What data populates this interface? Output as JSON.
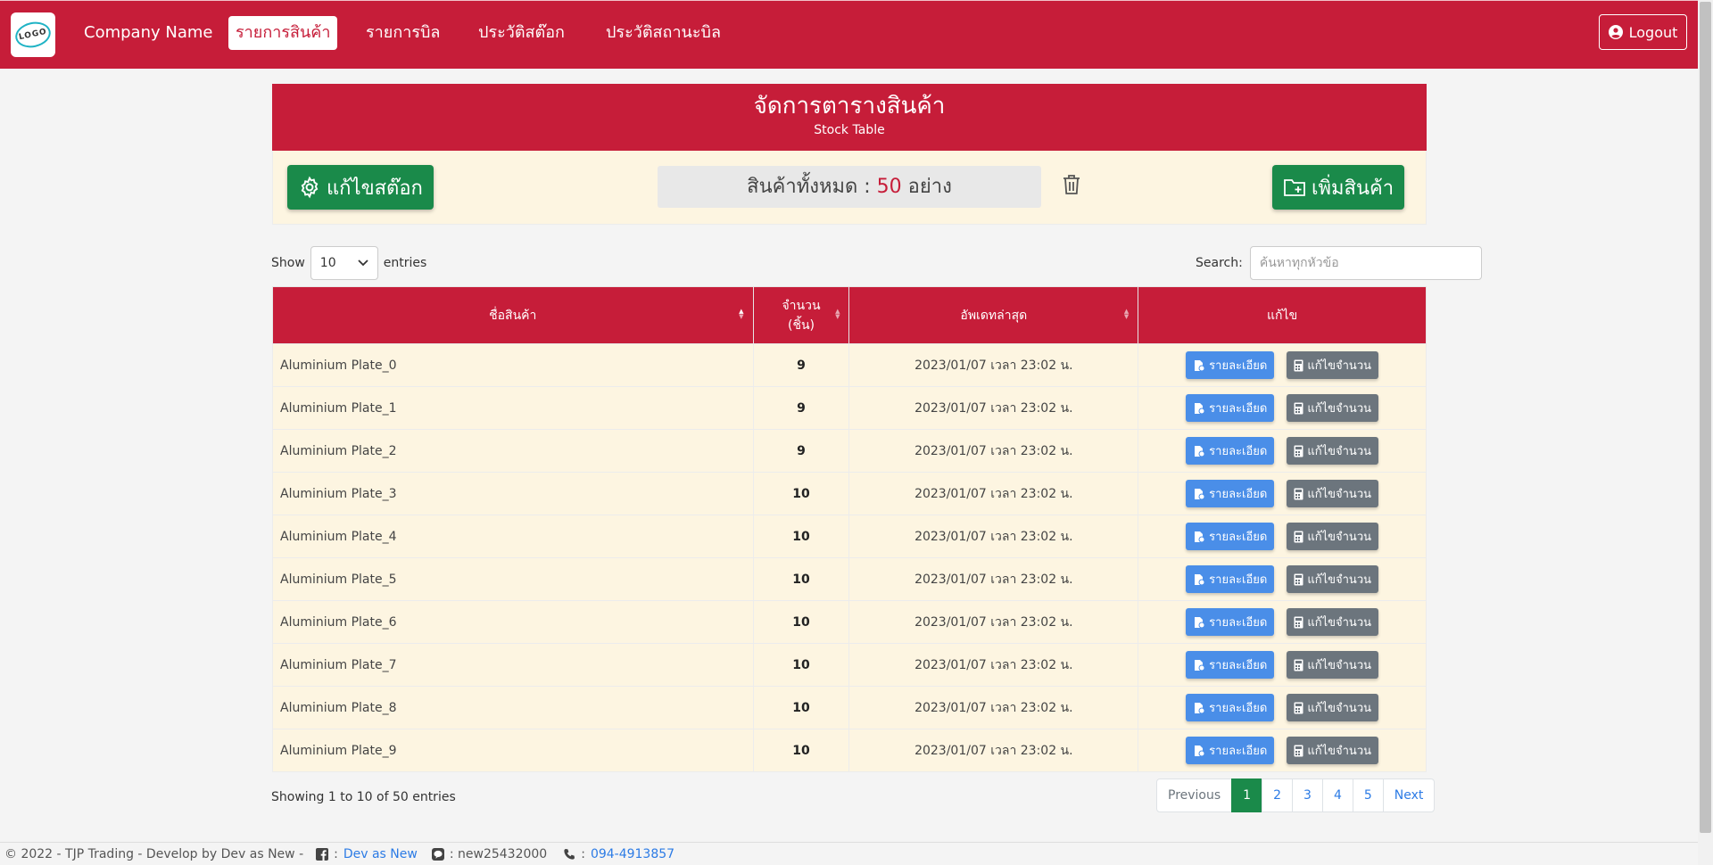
{
  "nav": {
    "logo_text": "LOGO",
    "company": "Company Name",
    "links": [
      "รายการสินค้า",
      "รายการบิล",
      "ประวัติสต๊อก",
      "ประวัติสถานะบิล"
    ],
    "logout": "Logout"
  },
  "panel": {
    "title": "จัดการตารางสินค้า",
    "subtitle": "Stock Table",
    "edit_stock": "แก้ไขสต๊อก",
    "total_prefix": "สินค้าทั้งหมด :",
    "total_count": "50",
    "total_suffix": "อย่าง",
    "add_product": "เพิ่มสินค้า"
  },
  "controls": {
    "show": "Show",
    "length": "10",
    "entries": "entries",
    "search_label": "Search:",
    "search_placeholder": "ค้นหาทุกหัวข้อ"
  },
  "table": {
    "headers": {
      "name": "ชื่อสินค้า",
      "qty_line1": "จำนวน",
      "qty_line2": "(ชิ้น)",
      "updated": "อัพเดทล่าสุด",
      "edit": "แก้ไข"
    },
    "detail_label": "รายละเอียด",
    "edit_qty_label": "แก้ไขจำนวน",
    "rows": [
      {
        "name": "Aluminium Plate_0",
        "qty": "9",
        "updated": "2023/01/07 เวลา 23:02 น."
      },
      {
        "name": "Aluminium Plate_1",
        "qty": "9",
        "updated": "2023/01/07 เวลา 23:02 น."
      },
      {
        "name": "Aluminium Plate_2",
        "qty": "9",
        "updated": "2023/01/07 เวลา 23:02 น."
      },
      {
        "name": "Aluminium Plate_3",
        "qty": "10",
        "updated": "2023/01/07 เวลา 23:02 น."
      },
      {
        "name": "Aluminium Plate_4",
        "qty": "10",
        "updated": "2023/01/07 เวลา 23:02 น."
      },
      {
        "name": "Aluminium Plate_5",
        "qty": "10",
        "updated": "2023/01/07 เวลา 23:02 น."
      },
      {
        "name": "Aluminium Plate_6",
        "qty": "10",
        "updated": "2023/01/07 เวลา 23:02 น."
      },
      {
        "name": "Aluminium Plate_7",
        "qty": "10",
        "updated": "2023/01/07 เวลา 23:02 น."
      },
      {
        "name": "Aluminium Plate_8",
        "qty": "10",
        "updated": "2023/01/07 เวลา 23:02 น."
      },
      {
        "name": "Aluminium Plate_9",
        "qty": "10",
        "updated": "2023/01/07 เวลา 23:02 น."
      }
    ]
  },
  "info": "Showing 1 to 10 of 50 entries",
  "pagination": {
    "previous": "Previous",
    "pages": [
      "1",
      "2",
      "3",
      "4",
      "5"
    ],
    "active": "1",
    "next": "Next"
  },
  "footer": {
    "copyright": "© 2022 - TJP Trading - Develop by Dev as New -",
    "facebook_sep": ":",
    "facebook": "Dev as New",
    "line": ": new25432000",
    "phone_sep": ":",
    "phone": "094-4913857"
  },
  "colors": {
    "brand": "#c61d39",
    "green": "#1a8a4a",
    "cream": "#fdf5e1",
    "detail_button": "#4a8ee8",
    "edit_button": "#6c757d"
  },
  "icons": {
    "edit_stock": "gear-icon",
    "delete": "trash-icon",
    "add": "folder-plus-icon",
    "logout": "user-circle-icon",
    "detail": "file-icon",
    "edit_qty": "calculator-icon",
    "facebook": "facebook-icon",
    "line": "line-icon",
    "phone": "phone-icon"
  }
}
